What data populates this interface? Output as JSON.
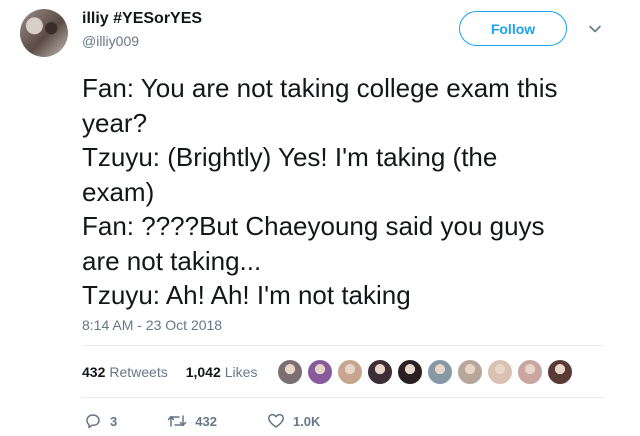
{
  "user": {
    "display_name": "illiy #YESorYES",
    "handle": "@illiy009"
  },
  "follow_label": "Follow",
  "tweet_text": "Fan: You are not taking college exam this\nyear?\nTzuyu: (Brightly) Yes! I'm taking (the\nexam)\nFan: ????But Chaeyoung said you guys\nare not taking...\nTzuyu: Ah! Ah! I'm not taking",
  "timestamp": "8:14 AM - 23 Oct 2018",
  "stats": {
    "retweets_count": "432",
    "retweets_label": "Retweets",
    "likes_count": "1,042",
    "likes_label": "Likes"
  },
  "liker_avatar_colors": [
    "#7b6f73",
    "#8a5a9e",
    "#c7a58e",
    "#3d2f35",
    "#2a2024",
    "#8899a6",
    "#b7a79a",
    "#d9c2b3",
    "#c9a7a0",
    "#5a3a36"
  ],
  "actions": {
    "reply_count": "3",
    "retweet_count": "432",
    "like_count": "1.0K"
  },
  "colors": {
    "accent": "#1da1f2",
    "secondary_text": "#657786",
    "primary_text": "#14171a",
    "divider": "#e6ecf0"
  },
  "icons": [
    "reply-icon",
    "retweet-icon",
    "heart-icon",
    "chevron-down-icon"
  ]
}
